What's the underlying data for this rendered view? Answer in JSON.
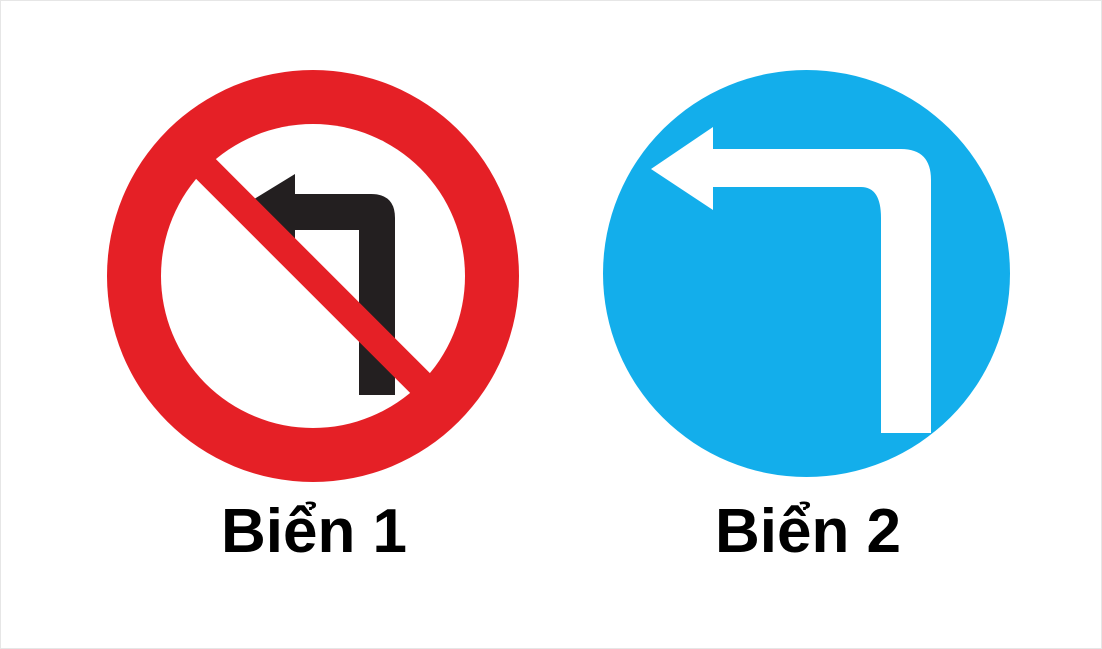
{
  "signs": [
    {
      "caption": "Biển 1",
      "ring_color": "#e52026",
      "inner_color": "#ffffff",
      "arrow_color": "#231f20",
      "slash_color": "#e52026",
      "icon": "no-left-turn-sign"
    },
    {
      "caption": "Biển 2",
      "circle_color": "#13aeeb",
      "arrow_color": "#ffffff",
      "icon": "turn-left-mandatory-sign"
    }
  ]
}
